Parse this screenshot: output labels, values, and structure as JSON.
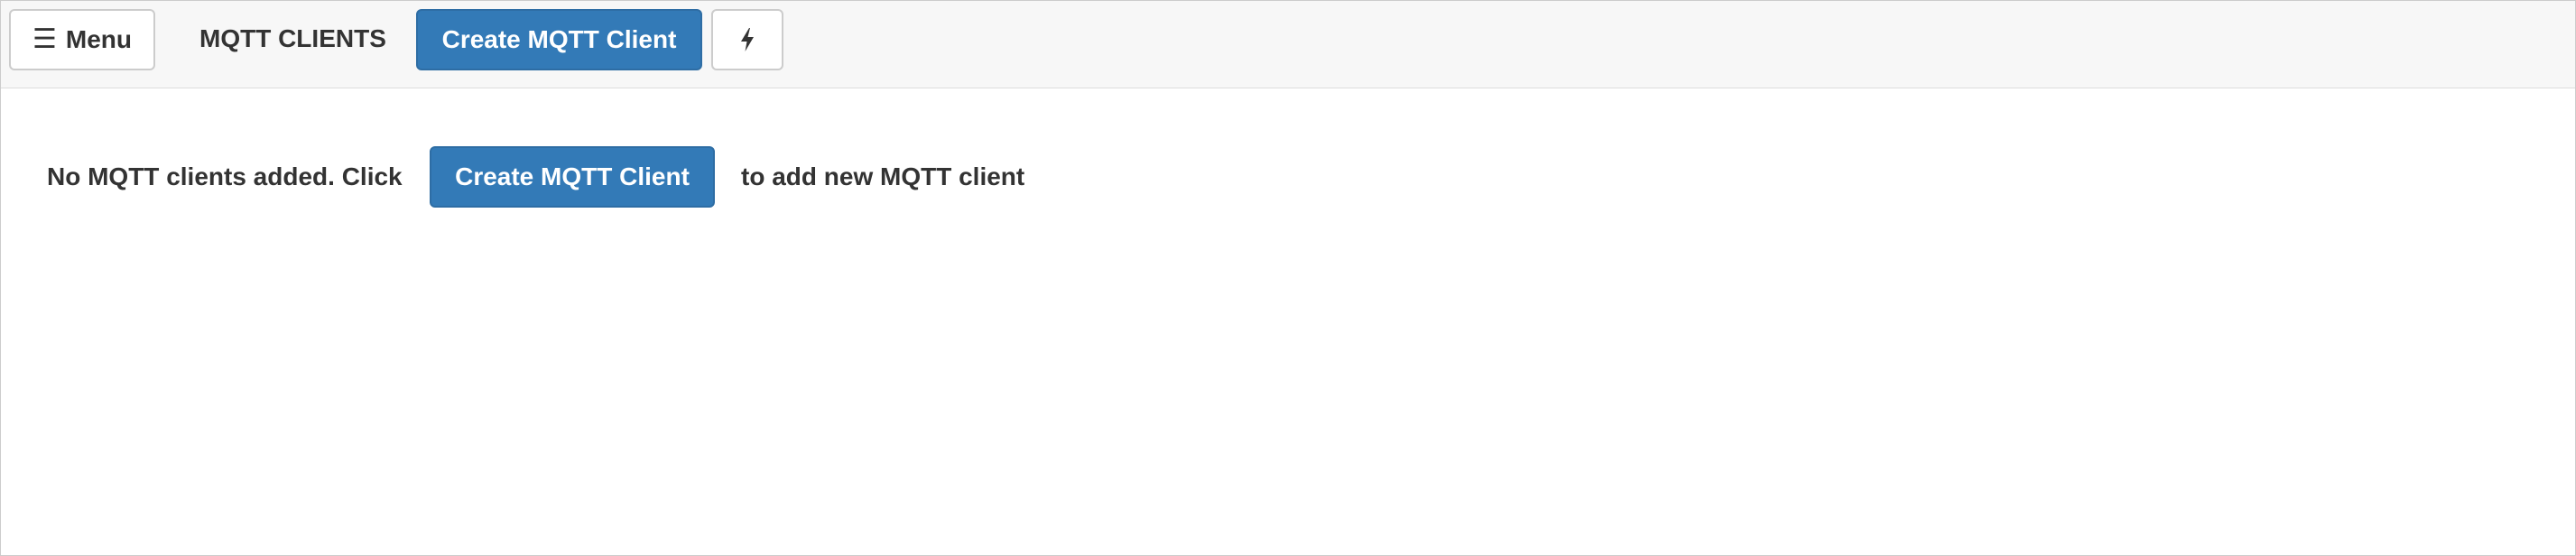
{
  "toolbar": {
    "menu_icon": "hamburger-icon",
    "menu_glyph": "☰",
    "menu_label": "Menu",
    "title": "MQTT CLIENTS",
    "create_label": "Create MQTT Client",
    "bolt_icon": "lightning-bolt-icon"
  },
  "empty_state": {
    "text_before": "No MQTT clients added. Click",
    "button_label": "Create MQTT Client",
    "text_after": "to add new MQTT client"
  },
  "colors": {
    "primary": "#337ab7",
    "toolbar_bg": "#f7f7f7",
    "text": "#333333"
  }
}
